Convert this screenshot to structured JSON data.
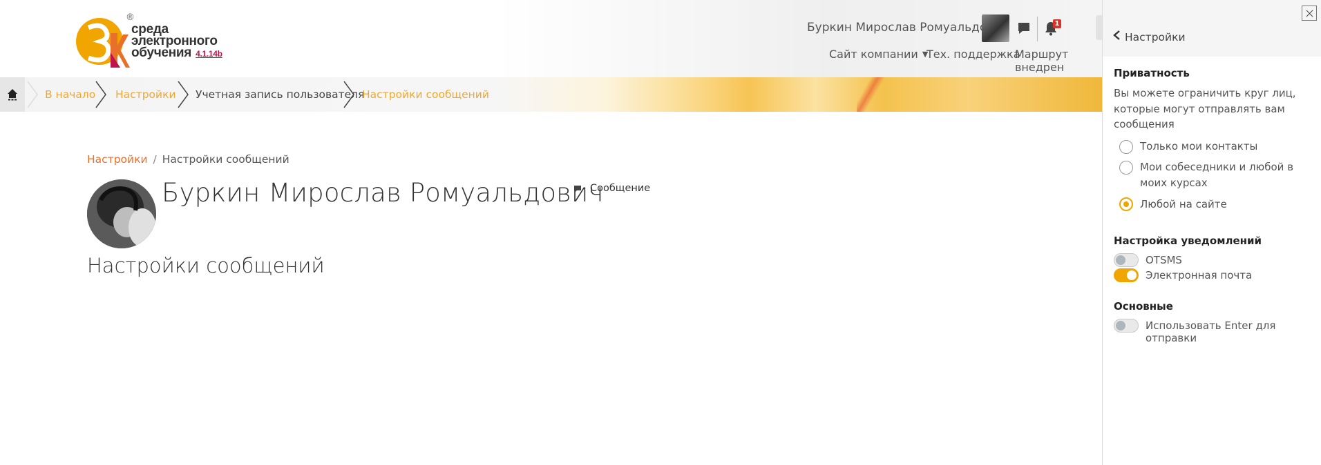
{
  "header": {
    "logo": {
      "line1": "среда",
      "line2": "электронного",
      "line3": "обучения",
      "version": "4.1.14b",
      "registered": "®"
    },
    "user_name": "Буркин Мирослав Ромуальдович",
    "notification_count": "1",
    "nav": {
      "company_site": "Сайт компании",
      "support": "Тех. поддержка",
      "route": "Маршрут внедрен"
    }
  },
  "breadcrumb": {
    "items": [
      "В начало",
      "Настройки",
      "Учетная запись пользователя",
      "Настройки сообщений"
    ]
  },
  "main": {
    "sub_breadcrumb": {
      "link": "Настройки",
      "separator": "/",
      "current": "Настройки сообщений"
    },
    "profile_name": "Буркин Мирослав Ромуальдович",
    "message_label": "Сообщение",
    "section_title": "Настройки сообщений"
  },
  "drawer": {
    "back_label": "Настройки",
    "privacy": {
      "heading": "Приватность",
      "description": "Вы можете ограничить круг лиц, которые могут отправлять вам сообщения",
      "options": [
        {
          "label": "Только мои контакты",
          "selected": false
        },
        {
          "label": "Мои собеседники и любой в моих курсах",
          "selected": false
        },
        {
          "label": "Любой на сайте",
          "selected": true
        }
      ]
    },
    "notifications": {
      "heading": "Настройка уведомлений",
      "toggles": [
        {
          "label": "OTSMS",
          "on": false
        },
        {
          "label": "Электронная почта",
          "on": true
        }
      ]
    },
    "general": {
      "heading": "Основные",
      "toggles": [
        {
          "label": "Использовать Enter для отправки",
          "on": false
        }
      ]
    }
  },
  "colors": {
    "accent": "#f0a500",
    "link_orange": "#e8702a",
    "crumb_orange": "#f0a830",
    "badge_red": "#d9342b",
    "logo_version": "#c0134b"
  }
}
